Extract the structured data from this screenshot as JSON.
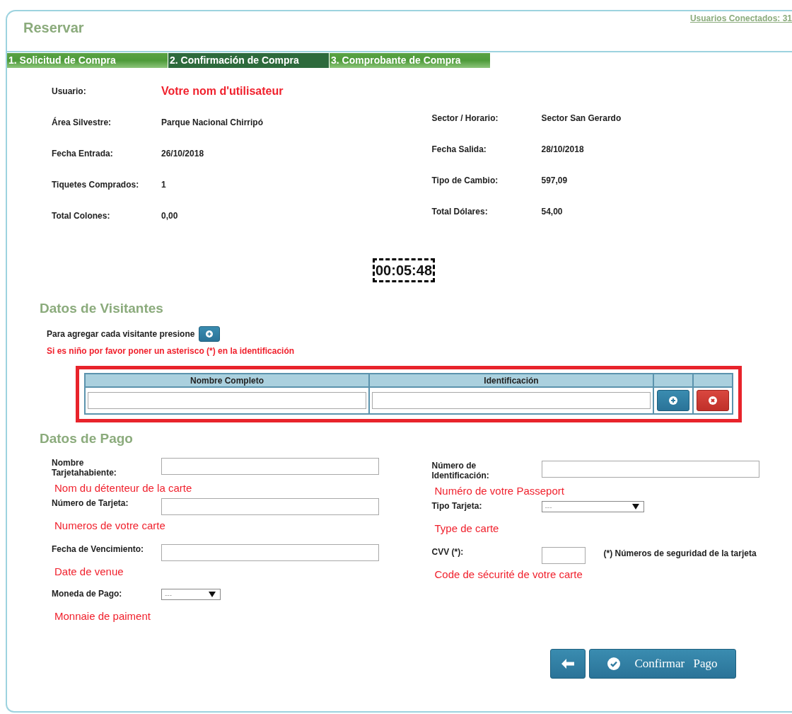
{
  "header": {
    "title": "Reservar",
    "connected_link": "Usuarios Conectados: 31"
  },
  "steps": [
    {
      "label": "1. Solicitud de Compra",
      "selected": false
    },
    {
      "label": "2. Confirmación de Compra",
      "selected": true
    },
    {
      "label": "3. Comprobante de Compra",
      "selected": false
    }
  ],
  "summary": {
    "user_label": "Usuario:",
    "user_value": "Votre nom d'utilisateur",
    "left": [
      {
        "label": "Área Silvestre:",
        "value": "Parque Nacional Chirripó"
      },
      {
        "label": "Fecha Entrada:",
        "value": "26/10/2018"
      },
      {
        "label": "Tiquetes Comprados:",
        "value": "1"
      },
      {
        "label": "Total Colones:",
        "value": "0,00"
      }
    ],
    "right": [
      {
        "label": "Sector / Horario:",
        "value": "Sector San Gerardo"
      },
      {
        "label": "Fecha Salida:",
        "value": "28/10/2018"
      },
      {
        "label": "Tipo de Cambio:",
        "value": "597,09"
      },
      {
        "label": "Total Dólares:",
        "value": "54,00"
      }
    ]
  },
  "timer": "00:05:48",
  "visitors": {
    "title": "Datos de Visitantes",
    "instruction": "Para agregar cada visitante presione",
    "child_note": "Si es niño por favor poner un asterisco (*) en la identificación",
    "columns": [
      "Nombre Completo",
      "Identificación"
    ]
  },
  "payment": {
    "title": "Datos de Pago",
    "left": [
      {
        "label": "Nombre Tarjetahabiente:",
        "kind": "text",
        "note": "Nom du détenteur de la carte"
      },
      {
        "label": "Número de Tarjeta:",
        "kind": "text",
        "note": "Numeros de votre carte"
      },
      {
        "label": "Fecha de Vencimiento:",
        "kind": "text",
        "note": "Date de venue"
      },
      {
        "label": "Moneda de Pago:",
        "kind": "select",
        "value": "---",
        "note": "Monnaie de paiment"
      }
    ],
    "right": [
      {
        "label": "Número de Identificación:",
        "kind": "text",
        "note": "Numéro de votre Passeport"
      },
      {
        "label": "Tipo Tarjeta:",
        "kind": "select",
        "value": "---",
        "note": "Type de carte"
      },
      {
        "label": "CVV (*):",
        "kind": "short",
        "hint": "(*) Números de seguridad de la tarjeta",
        "note": "Code de sécurité de votre carte"
      }
    ]
  },
  "confirm_button": "Confirmar Pago"
}
